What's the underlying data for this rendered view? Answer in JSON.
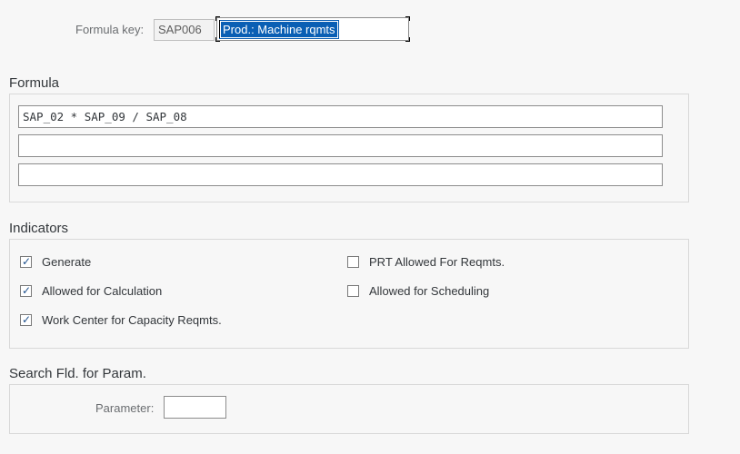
{
  "formula_key": {
    "label": "Formula key:",
    "code": "SAP006",
    "description": "Prod.: Machine rqmts"
  },
  "formula": {
    "title": "Formula",
    "lines": [
      "SAP_02 * SAP_09 / SAP_08",
      "",
      ""
    ]
  },
  "indicators": {
    "title": "Indicators",
    "items": [
      {
        "label": "Generate",
        "checked": true
      },
      {
        "label": "Allowed for Calculation",
        "checked": true
      },
      {
        "label": "Work Center for Capacity Reqmts.",
        "checked": true
      },
      {
        "label": "PRT Allowed For Reqmts.",
        "checked": false
      },
      {
        "label": "Allowed for Scheduling",
        "checked": false
      }
    ]
  },
  "search": {
    "title": "Search Fld. for Param.",
    "parameter_label": "Parameter:",
    "parameter_value": ""
  },
  "colors": {
    "selection": "#0a5fb4",
    "checkmark": "#1d4f8c",
    "background": "#f7f7f7"
  }
}
